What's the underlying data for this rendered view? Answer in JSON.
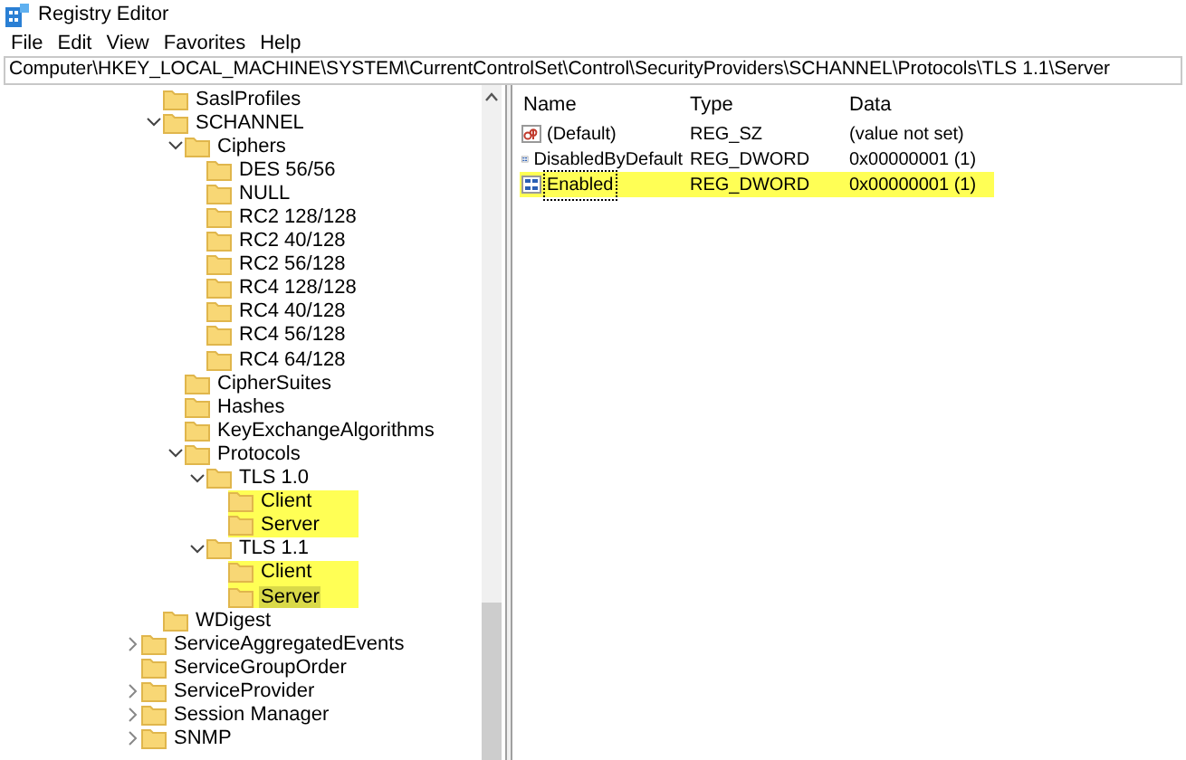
{
  "window": {
    "title": "Registry Editor"
  },
  "menu": [
    "File",
    "Edit",
    "View",
    "Favorites",
    "Help"
  ],
  "address": "Computer\\HKEY_LOCAL_MACHINE\\SYSTEM\\CurrentControlSet\\Control\\SecurityProviders\\SCHANNEL\\Protocols\\TLS 1.1\\Server",
  "tree": {
    "nested_items": [
      {
        "label": "SaslProfiles",
        "selected": false,
        "highlighted": false
      },
      {
        "label": "SCHANNEL",
        "expanded": true,
        "selected": false,
        "highlighted": false,
        "children": [
          {
            "label": "Ciphers",
            "expanded": true,
            "selected": false,
            "highlighted": false,
            "children": [
              {
                "label": "DES 56/56",
                "selected": false,
                "highlighted": false
              },
              {
                "label": "NULL",
                "selected": false,
                "highlighted": false
              },
              {
                "label": "RC2 128/128",
                "selected": false,
                "highlighted": false
              },
              {
                "label": "RC2 40/128",
                "selected": false,
                "highlighted": false
              },
              {
                "label": "RC2 56/128",
                "selected": false,
                "highlighted": false
              },
              {
                "label": "RC4 128/128",
                "selected": false,
                "highlighted": false
              },
              {
                "label": "RC4 40/128",
                "selected": false,
                "highlighted": false
              },
              {
                "label": "RC4 56/128",
                "selected": false,
                "highlighted": false
              },
              {
                "label": "RC4 64/128",
                "selected": false,
                "highlighted": false
              }
            ]
          },
          {
            "label": "CipherSuites",
            "selected": false,
            "highlighted": false
          },
          {
            "label": "Hashes",
            "selected": false,
            "highlighted": false
          },
          {
            "label": "KeyExchangeAlgorithms",
            "selected": false,
            "highlighted": false
          },
          {
            "label": "Protocols",
            "expanded": true,
            "selected": false,
            "highlighted": false,
            "children": [
              {
                "label": "TLS 1.0",
                "expanded": true,
                "selected": false,
                "highlighted": false,
                "children": [
                  {
                    "label": "Client",
                    "selected": false,
                    "highlighted": true
                  },
                  {
                    "label": "Server",
                    "selected": false,
                    "highlighted": true
                  }
                ]
              },
              {
                "label": "TLS 1.1",
                "expanded": true,
                "selected": false,
                "highlighted": false,
                "children": [
                  {
                    "label": "Client",
                    "selected": false,
                    "highlighted": true
                  },
                  {
                    "label": "Server",
                    "selected": true,
                    "highlighted": true
                  }
                ]
              }
            ]
          }
        ]
      },
      {
        "label": "WDigest",
        "selected": false,
        "highlighted": false
      }
    ],
    "items": [
      {
        "label": "ServiceAggregatedEvents",
        "expanded": false,
        "selected": false,
        "highlighted": false
      },
      {
        "label": "ServiceGroupOrder",
        "selected": false,
        "highlighted": false
      },
      {
        "label": "ServiceProvider",
        "expanded": false,
        "selected": false,
        "highlighted": false
      },
      {
        "label": "Session Manager",
        "expanded": false,
        "selected": false,
        "highlighted": false
      },
      {
        "label": "SNMP",
        "expanded": false,
        "selected": false,
        "highlighted": false
      }
    ]
  },
  "values": {
    "columns": [
      "Name",
      "Type",
      "Data"
    ],
    "rows": [
      {
        "kind": "string",
        "name": "(Default)",
        "type": "REG_SZ",
        "data": "(value not set)",
        "selected": false,
        "highlighted": false
      },
      {
        "kind": "binary",
        "name": "DisabledByDefault",
        "type": "REG_DWORD",
        "data": "0x00000001 (1)",
        "selected": false,
        "highlighted": false
      },
      {
        "kind": "binary",
        "name": "Enabled",
        "type": "REG_DWORD",
        "data": "0x00000001 (1)",
        "selected": true,
        "highlighted": true
      }
    ]
  }
}
